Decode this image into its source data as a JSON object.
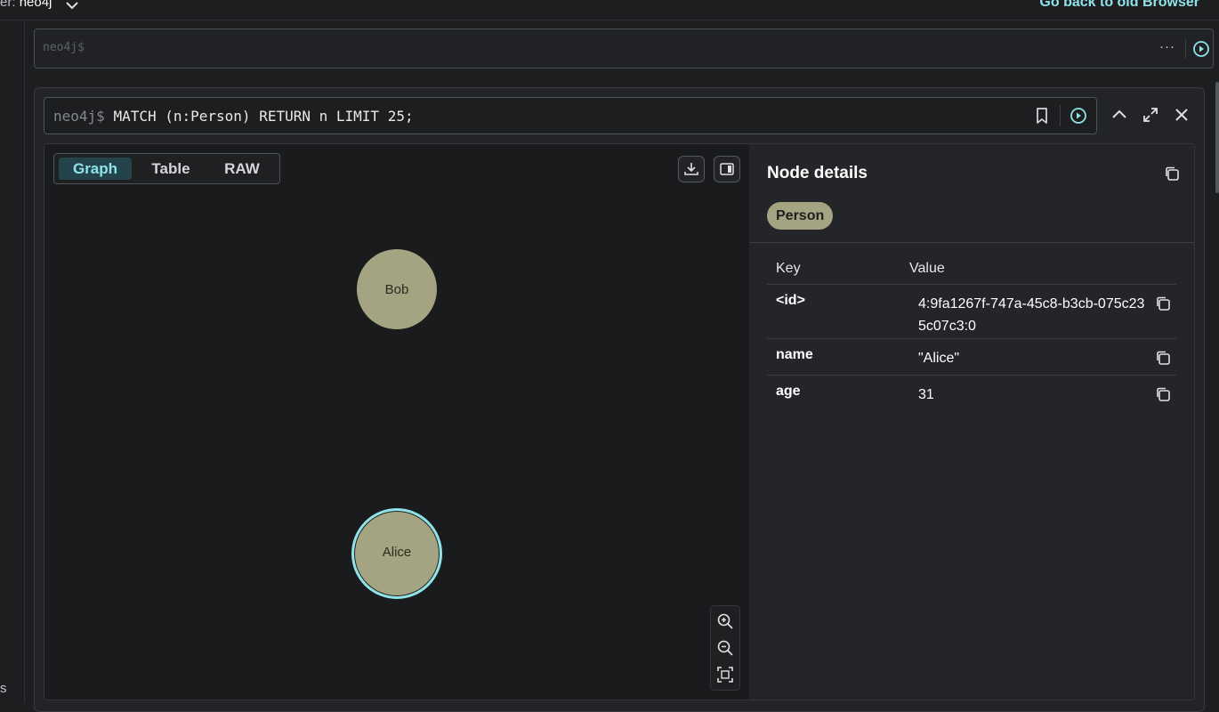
{
  "topbar": {
    "db_prefix": "er:",
    "db_name": "neo4j",
    "back_link": "Go back to old Browser"
  },
  "leftrail": {
    "partial_text": "s"
  },
  "main_editor": {
    "placeholder": "neo4j$",
    "more_label": "···"
  },
  "frame": {
    "prompt": "neo4j$",
    "query": "MATCH (n:Person) RETURN n LIMIT 25;"
  },
  "tabs": [
    {
      "label": "Graph",
      "active": true
    },
    {
      "label": "Table",
      "active": false
    },
    {
      "label": "RAW",
      "active": false
    }
  ],
  "graph": {
    "nodes": [
      {
        "label": "Bob",
        "selected": false,
        "color": "#a5a482"
      },
      {
        "label": "Alice",
        "selected": true,
        "color": "#a5a482",
        "selection_color": "#8fe3e8"
      }
    ]
  },
  "details": {
    "title": "Node details",
    "label_chip": "Person",
    "key_header": "Key",
    "value_header": "Value",
    "properties": [
      {
        "key": "<id>",
        "value": "4:9fa1267f-747a-45c8-b3cb-075c235c07c3:0"
      },
      {
        "key": "name",
        "value": "\"Alice\""
      },
      {
        "key": "age",
        "value": "31"
      }
    ]
  },
  "colors": {
    "accent": "#8fe3e8",
    "node": "#a5a482",
    "background": "#1a1b1d"
  }
}
